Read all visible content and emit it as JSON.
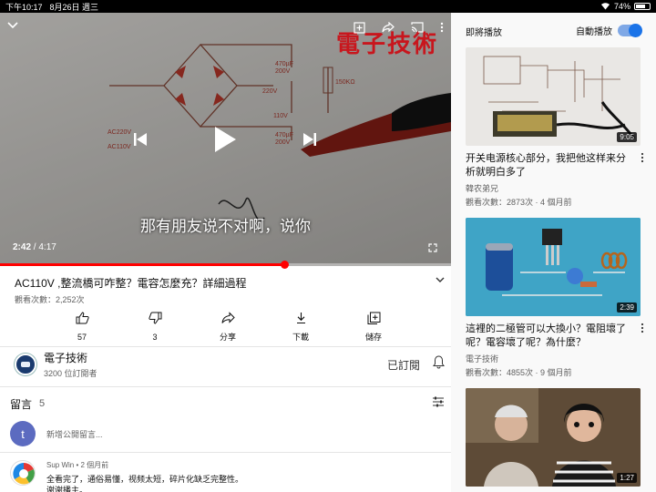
{
  "status_bar": {
    "time": "下午10:17",
    "date": "8月26日 週三",
    "battery": "74%",
    "battery_level": 0.74
  },
  "player": {
    "subtitle": "那有朋友说不对啊，说你",
    "current_time": "2:42",
    "separator": "/",
    "duration": "4:17",
    "progress": 0.63,
    "watermark": "電子技術"
  },
  "video": {
    "title": "AC110V ,整流橋可咋整？電容怎麼充？詳細過程",
    "views": "觀看次數：2,252次"
  },
  "actions": {
    "like_count": "57",
    "dislike_count": "3",
    "share_label": "分享",
    "download_label": "下載",
    "save_label": "儲存"
  },
  "channel": {
    "name": "電子技術",
    "subscribers": "3200 位訂閱者",
    "subscribed_label": "已訂閱"
  },
  "comments": {
    "label": "留言",
    "count": "5",
    "add_placeholder": "新增公開留言...",
    "user_initial": "t",
    "first": {
      "author_meta": "Sup Win • 2 個月前",
      "text_line1": "全看完了，通俗易懂，视频太短，碎片化缺乏完整性。",
      "text_line2": "谢谢播主。"
    }
  },
  "sidebar": {
    "up_next": "即將播放",
    "autoplay": "自動播放",
    "autoplay_on": true,
    "videos": [
      {
        "duration": "9:05",
        "title": "开关电源核心部分，我把他这样来分析就明白多了",
        "channel": "韓农弟兄",
        "meta": "觀看次數：2873次 · 4 個月前"
      },
      {
        "duration": "2:39",
        "title": "這裡的二極管可以大換小？電阻壞了呢？電容壞了呢？為什麼？",
        "channel": "電子技術",
        "meta": "觀看次數：4855次 · 9 個月前"
      },
      {
        "duration": "1:27"
      }
    ]
  },
  "colors": {
    "accent_red": "#ff0000",
    "toggle_blue": "#1a73e8",
    "watermark_red": "#c8161d"
  }
}
